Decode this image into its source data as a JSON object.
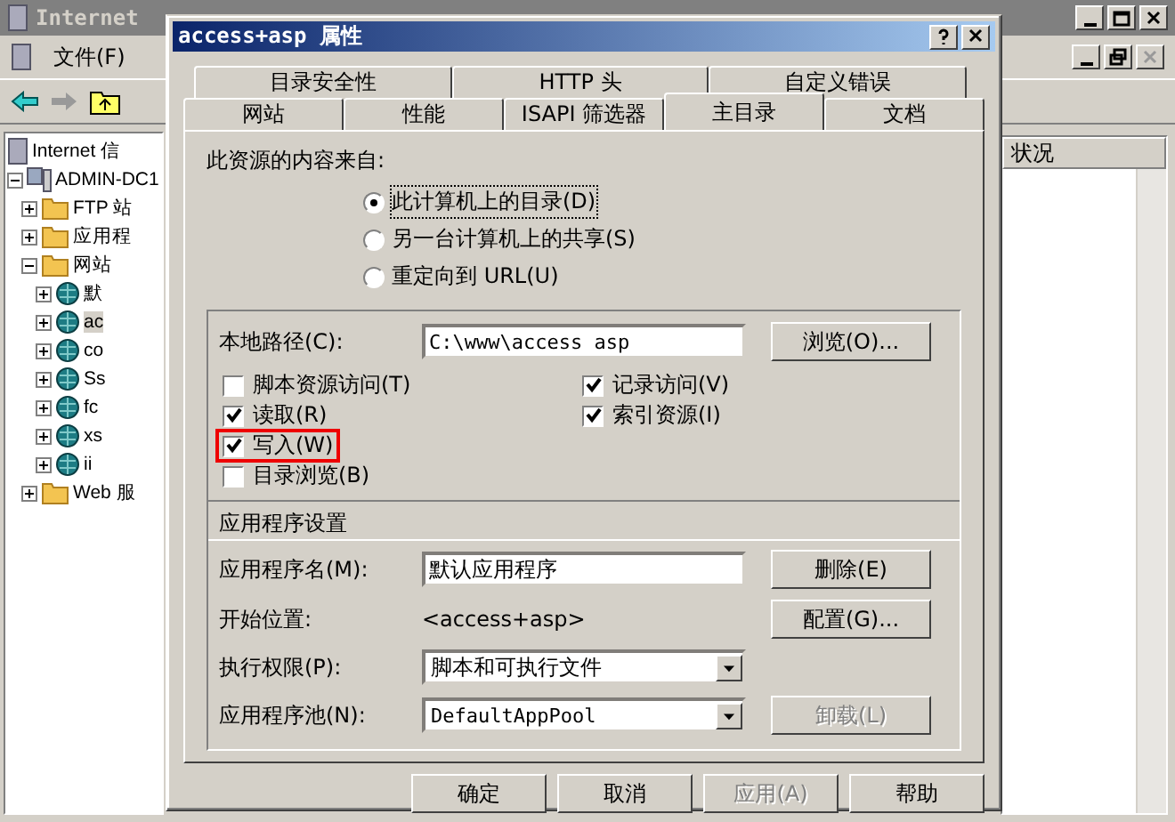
{
  "background_window": {
    "title": "Internet",
    "menu": [
      "文件(F)"
    ],
    "tree": [
      {
        "label": "Internet 信",
        "children": [
          {
            "label": "ADMIN-DC1",
            "expanded": true,
            "children": [
              {
                "label": "FTP 站",
                "expanded": false
              },
              {
                "label": "应用程",
                "expanded": false
              },
              {
                "label": "网站",
                "expanded": true,
                "children": [
                  {
                    "label": "默",
                    "expanded": false,
                    "selected": false
                  },
                  {
                    "label": "ac",
                    "expanded": false,
                    "selected": true
                  },
                  {
                    "label": "co",
                    "expanded": false,
                    "selected": false
                  },
                  {
                    "label": "Ss",
                    "expanded": false,
                    "selected": false
                  },
                  {
                    "label": "fc",
                    "expanded": false,
                    "selected": false
                  },
                  {
                    "label": "xs",
                    "expanded": false,
                    "selected": false
                  },
                  {
                    "label": "ii",
                    "expanded": false,
                    "selected": false
                  }
                ]
              },
              {
                "label": "Web 服",
                "expanded": false
              }
            ]
          }
        ]
      }
    ],
    "list_header": "状况"
  },
  "dialog": {
    "title": "access+asp 属性",
    "tab_rows": [
      [
        {
          "label": "目录安全性",
          "selected": false
        },
        {
          "label": "HTTP 头",
          "selected": false
        },
        {
          "label": "自定义错误",
          "selected": false
        }
      ],
      [
        {
          "label": "网站",
          "selected": false
        },
        {
          "label": "性能",
          "selected": false
        },
        {
          "label": "ISAPI 筛选器",
          "selected": false
        },
        {
          "label": "主目录",
          "selected": true
        },
        {
          "label": "文档",
          "selected": false
        }
      ]
    ],
    "source_label": "此资源的内容来自:",
    "source_options": [
      {
        "label": "此计算机上的目录(D)",
        "selected": true
      },
      {
        "label": "另一台计算机上的共享(S)",
        "selected": false
      },
      {
        "label": "重定向到 URL(U)",
        "selected": false
      }
    ],
    "local_path": {
      "label": "本地路径(C):",
      "value": "C:\\www\\access asp",
      "button": "浏览(O)..."
    },
    "permissions_left": [
      {
        "label": "脚本资源访问(T)",
        "checked": false,
        "highlighted": false
      },
      {
        "label": "读取(R)",
        "checked": true,
        "highlighted": false
      },
      {
        "label": "写入(W)",
        "checked": true,
        "highlighted": true
      },
      {
        "label": "目录浏览(B)",
        "checked": false,
        "highlighted": false
      }
    ],
    "permissions_right": [
      {
        "label": "记录访问(V)",
        "checked": true
      },
      {
        "label": "索引资源(I)",
        "checked": true
      }
    ],
    "app_settings": {
      "heading": "应用程序设置",
      "app_name": {
        "label": "应用程序名(M):",
        "value": "默认应用程序",
        "button": "删除(E)"
      },
      "start_point": {
        "label": "开始位置:",
        "value": "<access+asp>",
        "button": "配置(G)..."
      },
      "execute_permissions": {
        "label": "执行权限(P):",
        "value": "脚本和可执行文件"
      },
      "app_pool": {
        "label": "应用程序池(N):",
        "value": "DefaultAppPool",
        "button": "卸载(L)",
        "button_disabled": true
      }
    },
    "buttons": [
      {
        "label": "确定",
        "disabled": false
      },
      {
        "label": "取消",
        "disabled": false
      },
      {
        "label": "应用(A)",
        "disabled": true
      },
      {
        "label": "帮助",
        "disabled": false
      }
    ]
  }
}
